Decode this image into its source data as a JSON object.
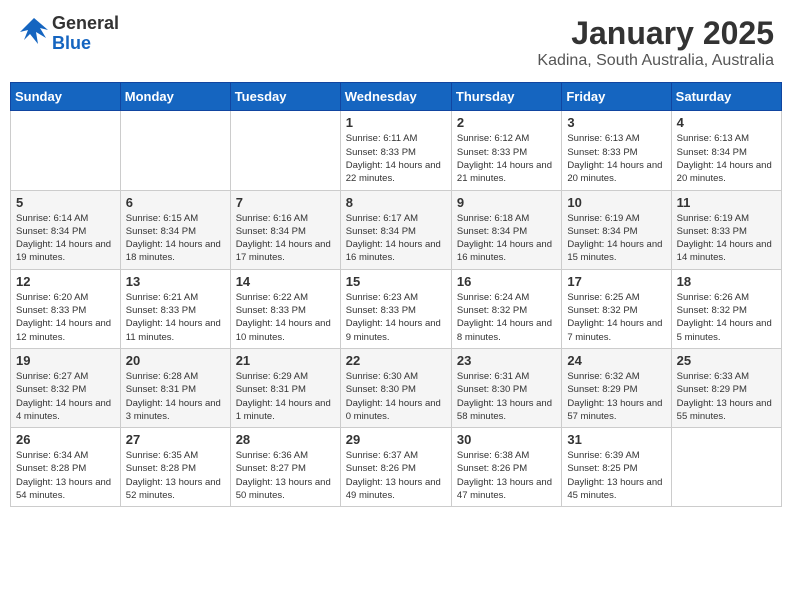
{
  "header": {
    "logo_general": "General",
    "logo_blue": "Blue",
    "title": "January 2025",
    "subtitle": "Kadina, South Australia, Australia"
  },
  "weekdays": [
    "Sunday",
    "Monday",
    "Tuesday",
    "Wednesday",
    "Thursday",
    "Friday",
    "Saturday"
  ],
  "weeks": [
    [
      {
        "day": "",
        "info": ""
      },
      {
        "day": "",
        "info": ""
      },
      {
        "day": "",
        "info": ""
      },
      {
        "day": "1",
        "info": "Sunrise: 6:11 AM\nSunset: 8:33 PM\nDaylight: 14 hours and 22 minutes."
      },
      {
        "day": "2",
        "info": "Sunrise: 6:12 AM\nSunset: 8:33 PM\nDaylight: 14 hours and 21 minutes."
      },
      {
        "day": "3",
        "info": "Sunrise: 6:13 AM\nSunset: 8:33 PM\nDaylight: 14 hours and 20 minutes."
      },
      {
        "day": "4",
        "info": "Sunrise: 6:13 AM\nSunset: 8:34 PM\nDaylight: 14 hours and 20 minutes."
      }
    ],
    [
      {
        "day": "5",
        "info": "Sunrise: 6:14 AM\nSunset: 8:34 PM\nDaylight: 14 hours and 19 minutes."
      },
      {
        "day": "6",
        "info": "Sunrise: 6:15 AM\nSunset: 8:34 PM\nDaylight: 14 hours and 18 minutes."
      },
      {
        "day": "7",
        "info": "Sunrise: 6:16 AM\nSunset: 8:34 PM\nDaylight: 14 hours and 17 minutes."
      },
      {
        "day": "8",
        "info": "Sunrise: 6:17 AM\nSunset: 8:34 PM\nDaylight: 14 hours and 16 minutes."
      },
      {
        "day": "9",
        "info": "Sunrise: 6:18 AM\nSunset: 8:34 PM\nDaylight: 14 hours and 16 minutes."
      },
      {
        "day": "10",
        "info": "Sunrise: 6:19 AM\nSunset: 8:34 PM\nDaylight: 14 hours and 15 minutes."
      },
      {
        "day": "11",
        "info": "Sunrise: 6:19 AM\nSunset: 8:33 PM\nDaylight: 14 hours and 14 minutes."
      }
    ],
    [
      {
        "day": "12",
        "info": "Sunrise: 6:20 AM\nSunset: 8:33 PM\nDaylight: 14 hours and 12 minutes."
      },
      {
        "day": "13",
        "info": "Sunrise: 6:21 AM\nSunset: 8:33 PM\nDaylight: 14 hours and 11 minutes."
      },
      {
        "day": "14",
        "info": "Sunrise: 6:22 AM\nSunset: 8:33 PM\nDaylight: 14 hours and 10 minutes."
      },
      {
        "day": "15",
        "info": "Sunrise: 6:23 AM\nSunset: 8:33 PM\nDaylight: 14 hours and 9 minutes."
      },
      {
        "day": "16",
        "info": "Sunrise: 6:24 AM\nSunset: 8:32 PM\nDaylight: 14 hours and 8 minutes."
      },
      {
        "day": "17",
        "info": "Sunrise: 6:25 AM\nSunset: 8:32 PM\nDaylight: 14 hours and 7 minutes."
      },
      {
        "day": "18",
        "info": "Sunrise: 6:26 AM\nSunset: 8:32 PM\nDaylight: 14 hours and 5 minutes."
      }
    ],
    [
      {
        "day": "19",
        "info": "Sunrise: 6:27 AM\nSunset: 8:32 PM\nDaylight: 14 hours and 4 minutes."
      },
      {
        "day": "20",
        "info": "Sunrise: 6:28 AM\nSunset: 8:31 PM\nDaylight: 14 hours and 3 minutes."
      },
      {
        "day": "21",
        "info": "Sunrise: 6:29 AM\nSunset: 8:31 PM\nDaylight: 14 hours and 1 minute."
      },
      {
        "day": "22",
        "info": "Sunrise: 6:30 AM\nSunset: 8:30 PM\nDaylight: 14 hours and 0 minutes."
      },
      {
        "day": "23",
        "info": "Sunrise: 6:31 AM\nSunset: 8:30 PM\nDaylight: 13 hours and 58 minutes."
      },
      {
        "day": "24",
        "info": "Sunrise: 6:32 AM\nSunset: 8:29 PM\nDaylight: 13 hours and 57 minutes."
      },
      {
        "day": "25",
        "info": "Sunrise: 6:33 AM\nSunset: 8:29 PM\nDaylight: 13 hours and 55 minutes."
      }
    ],
    [
      {
        "day": "26",
        "info": "Sunrise: 6:34 AM\nSunset: 8:28 PM\nDaylight: 13 hours and 54 minutes."
      },
      {
        "day": "27",
        "info": "Sunrise: 6:35 AM\nSunset: 8:28 PM\nDaylight: 13 hours and 52 minutes."
      },
      {
        "day": "28",
        "info": "Sunrise: 6:36 AM\nSunset: 8:27 PM\nDaylight: 13 hours and 50 minutes."
      },
      {
        "day": "29",
        "info": "Sunrise: 6:37 AM\nSunset: 8:26 PM\nDaylight: 13 hours and 49 minutes."
      },
      {
        "day": "30",
        "info": "Sunrise: 6:38 AM\nSunset: 8:26 PM\nDaylight: 13 hours and 47 minutes."
      },
      {
        "day": "31",
        "info": "Sunrise: 6:39 AM\nSunset: 8:25 PM\nDaylight: 13 hours and 45 minutes."
      },
      {
        "day": "",
        "info": ""
      }
    ]
  ]
}
